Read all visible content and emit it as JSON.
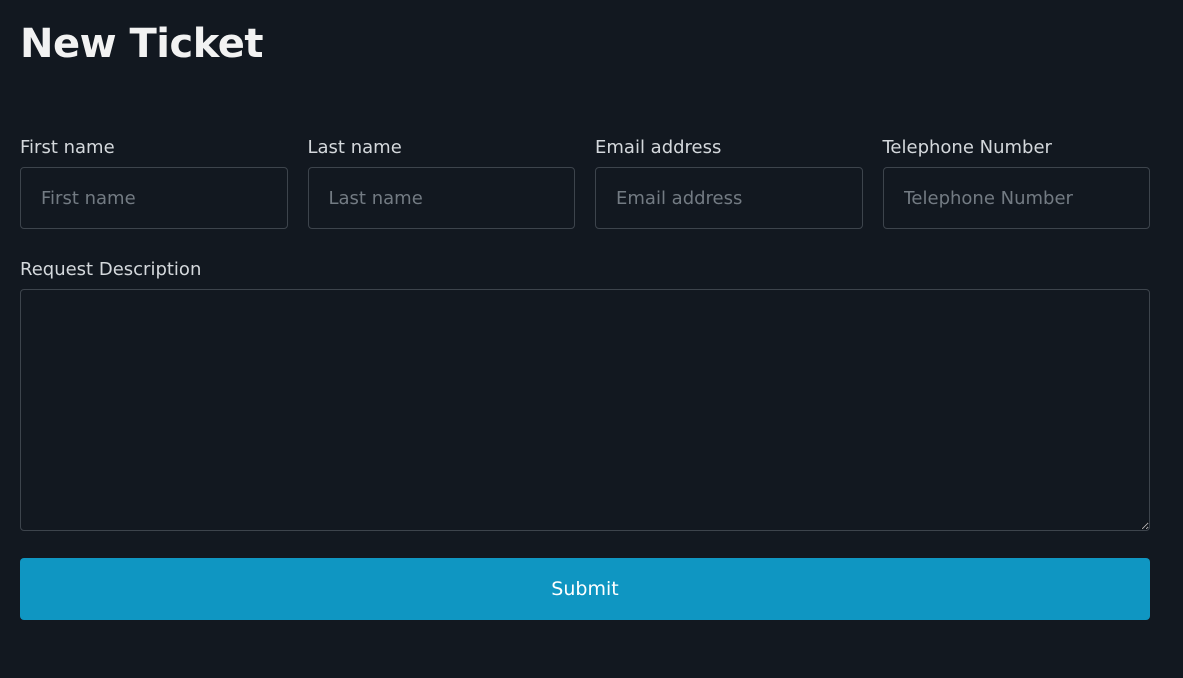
{
  "page": {
    "title": "New Ticket"
  },
  "form": {
    "fields": [
      {
        "label": "First name",
        "placeholder": "First name",
        "value": ""
      },
      {
        "label": "Last name",
        "placeholder": "Last name",
        "value": ""
      },
      {
        "label": "Email address",
        "placeholder": "Email address",
        "value": ""
      },
      {
        "label": "Telephone Number",
        "placeholder": "Telephone Number",
        "value": ""
      }
    ],
    "description": {
      "label": "Request Description",
      "value": ""
    },
    "submit_label": "Submit"
  },
  "colors": {
    "background": "#121820",
    "accent": "#0f96c2",
    "border": "#3d444c",
    "label": "#d4d8dc",
    "placeholder": "#737b83"
  }
}
